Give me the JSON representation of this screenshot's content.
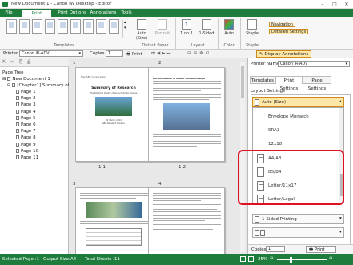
{
  "window": {
    "title": "New Document 1 - Canon iW Desktop - Editor",
    "min": "–",
    "max": "□",
    "close": "✕"
  },
  "menu": {
    "tabs": [
      "File",
      "Print Settings",
      "Print Options",
      "Annotations",
      "Tools"
    ],
    "active": "Print Settings"
  },
  "ribbon": {
    "templates_label": "Templates",
    "auto_size_label": "Auto (Size)",
    "portrait_label": "Portrait",
    "pages_per_sheet_value": "1",
    "pages_per_sheet_label": "1 on 1",
    "sided_label": "1-Sided",
    "color_label": "Auto",
    "staple_label": "Staple",
    "output_paper_label": "Output Paper",
    "layout_group_label": "Layout",
    "color_group_label": "Color",
    "staple_group_label": "Staple",
    "navigation_label": "Navigation",
    "detailed_settings_label": "Detailed Settings",
    "display_annotations_label": "Display Annotations"
  },
  "printerbar": {
    "printer_label": "Printer",
    "printer_value": "Canon iR-ADV",
    "copies_label": "Copies",
    "copies_value": "1",
    "print_label": "Print"
  },
  "pagetree": {
    "title": "Page Tree",
    "root": "New Document 1",
    "chapter": "[Chapter1] Summary of R",
    "pages": [
      "Page 1",
      "Page 2",
      "Page 3",
      "Page 4",
      "Page 5",
      "Page 6",
      "Page 7",
      "Page 8",
      "Page 9",
      "Page 10",
      "Page 11"
    ]
  },
  "preview": {
    "sheet_numbers": [
      "1",
      "2",
      "3",
      "4"
    ],
    "page_labels": [
      "1-1",
      "1-2"
    ],
    "page1": {
      "company": "The ABC Corporation",
      "heading": "Summary of Research",
      "subheading": "The Potential Impact of Global Climate Change",
      "date": "31 March, 2014",
      "author": "ABC Research Division"
    },
    "page2": {
      "heading": "Documentation of Global Climate Change"
    }
  },
  "rightpanel": {
    "printer_label": "Printer Name",
    "printer_value": "Canon iR-ADV",
    "tabs": [
      "Templates",
      "Print Settings",
      "Page Settings"
    ],
    "active_tab": "Print Settings",
    "section_title": "Layout Settings",
    "selected": "Auto (Size)",
    "items": [
      "Envelope Monarch",
      "SRA3",
      "12x18"
    ],
    "highlighted_items": [
      "A4/A3",
      "B5/B4",
      "Letter/11x17",
      "Letter/Legal"
    ],
    "sided_value": "1-Sided Printing",
    "copies_label": "Copies:",
    "copies_value": "1",
    "print_button": "Print"
  },
  "status": {
    "selected_page": "Selected Page :1",
    "output_size": "Output Size:A4",
    "total_sheets": "Total Sheets :11",
    "zoom": "25%",
    "zoom_fraction": 0.25
  },
  "colors": {
    "brand": "#1e7d3c",
    "highlight": "#e01020"
  }
}
